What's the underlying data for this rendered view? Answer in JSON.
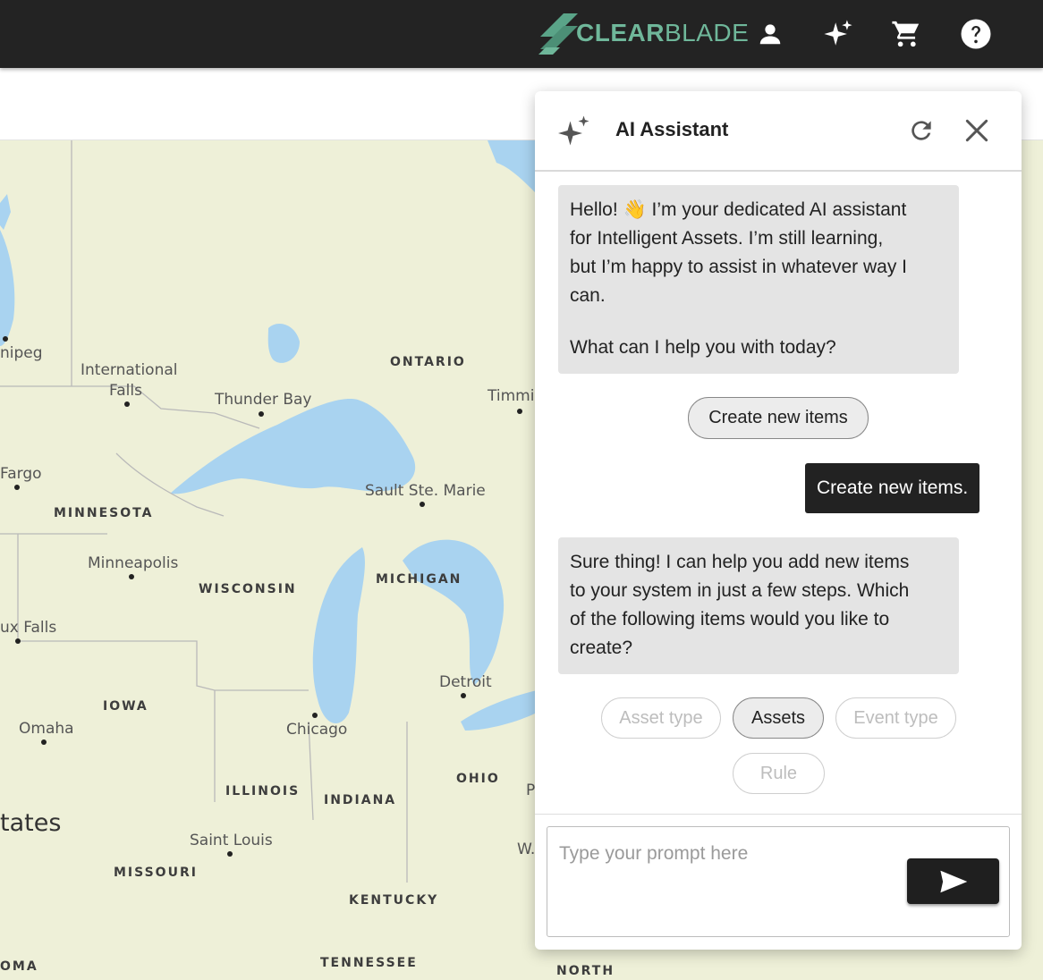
{
  "topbar": {
    "brand_bold": "CLEAR",
    "brand_light": "BLADE",
    "brand_color": "#6fb79a",
    "icons": [
      "user-icon",
      "sparkle-icon",
      "cart-icon",
      "help-icon"
    ]
  },
  "map": {
    "states": [
      "MINNESOTA",
      "WISCONSIN",
      "MICHIGAN",
      "IOWA",
      "ILLINOIS",
      "INDIANA",
      "OHIO",
      "MISSOURI",
      "KENTUCKY",
      "TENNESSEE",
      "ONTARIO",
      "NORTH",
      "OMA"
    ],
    "cities": [
      "nipeg",
      "International",
      "Falls",
      "Thunder Bay",
      "Timmi",
      "Fargo",
      "Sault Ste. Marie",
      "Minneapolis",
      "ux Falls",
      "Detroit",
      "Omaha",
      "Chicago",
      "tates",
      "Saint Louis",
      "P",
      "W."
    ]
  },
  "assistant": {
    "title": "AI Assistant",
    "messages": {
      "greeting_line1": "Hello! 👋 I’m your dedicated AI assistant",
      "greeting_line2": "for Intelligent Assets. I’m still learning,",
      "greeting_line3": "but I’m happy to assist in whatever way I",
      "greeting_line4": "can.",
      "greeting_line5": "What can I help you with today?",
      "suggestion": "Create new items",
      "user_message": "Create new items.",
      "reply_line1": "Sure thing! I can help you add new items",
      "reply_line2": "to your system in just a few steps. Which",
      "reply_line3": "of the following items would you like to",
      "reply_line4": "create?"
    },
    "options": [
      "Asset type",
      "Assets",
      "Event type",
      "Rule"
    ],
    "selected_option": "Assets",
    "input_placeholder": "Type your prompt here"
  }
}
